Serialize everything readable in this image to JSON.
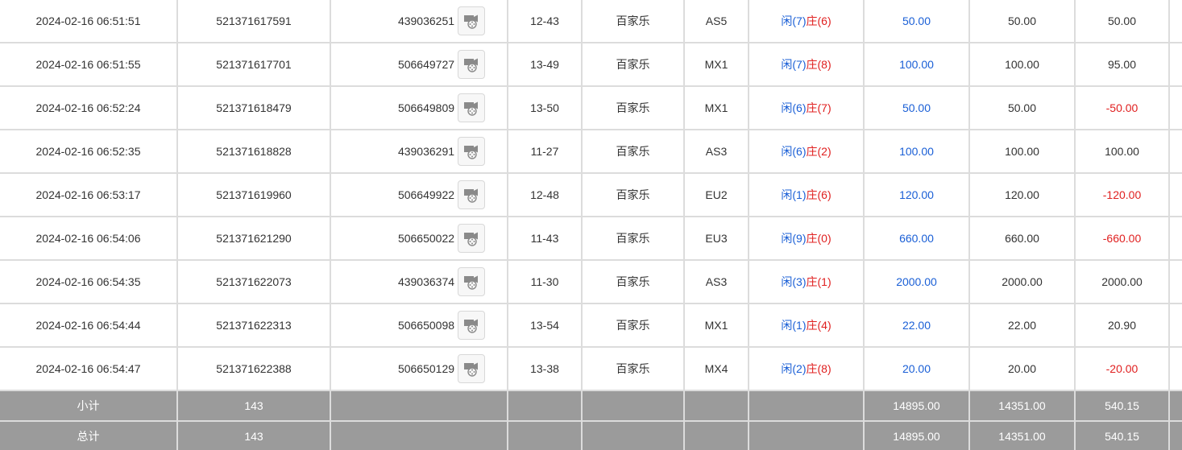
{
  "rows": [
    {
      "time": "2024-02-16 06:51:51",
      "bet_no": "521371617591",
      "round_no": "439036251",
      "shoe": "12-43",
      "game": "百家乐",
      "table": "AS5",
      "player_label": "闲(7)",
      "banker_label": "庄(6)",
      "bet_amount": "50.00",
      "valid_bet": "50.00",
      "win_loss": "50.00",
      "negative": false
    },
    {
      "time": "2024-02-16 06:51:55",
      "bet_no": "521371617701",
      "round_no": "506649727",
      "shoe": "13-49",
      "game": "百家乐",
      "table": "MX1",
      "player_label": "闲(7)",
      "banker_label": "庄(8)",
      "bet_amount": "100.00",
      "valid_bet": "100.00",
      "win_loss": "95.00",
      "negative": false
    },
    {
      "time": "2024-02-16 06:52:24",
      "bet_no": "521371618479",
      "round_no": "506649809",
      "shoe": "13-50",
      "game": "百家乐",
      "table": "MX1",
      "player_label": "闲(6)",
      "banker_label": "庄(7)",
      "bet_amount": "50.00",
      "valid_bet": "50.00",
      "win_loss": "-50.00",
      "negative": true
    },
    {
      "time": "2024-02-16 06:52:35",
      "bet_no": "521371618828",
      "round_no": "439036291",
      "shoe": "11-27",
      "game": "百家乐",
      "table": "AS3",
      "player_label": "闲(6)",
      "banker_label": "庄(2)",
      "bet_amount": "100.00",
      "valid_bet": "100.00",
      "win_loss": "100.00",
      "negative": false
    },
    {
      "time": "2024-02-16 06:53:17",
      "bet_no": "521371619960",
      "round_no": "506649922",
      "shoe": "12-48",
      "game": "百家乐",
      "table": "EU2",
      "player_label": "闲(1)",
      "banker_label": "庄(6)",
      "bet_amount": "120.00",
      "valid_bet": "120.00",
      "win_loss": "-120.00",
      "negative": true
    },
    {
      "time": "2024-02-16 06:54:06",
      "bet_no": "521371621290",
      "round_no": "506650022",
      "shoe": "11-43",
      "game": "百家乐",
      "table": "EU3",
      "player_label": "闲(9)",
      "banker_label": "庄(0)",
      "bet_amount": "660.00",
      "valid_bet": "660.00",
      "win_loss": "-660.00",
      "negative": true
    },
    {
      "time": "2024-02-16 06:54:35",
      "bet_no": "521371622073",
      "round_no": "439036374",
      "shoe": "11-30",
      "game": "百家乐",
      "table": "AS3",
      "player_label": "闲(3)",
      "banker_label": "庄(1)",
      "bet_amount": "2000.00",
      "valid_bet": "2000.00",
      "win_loss": "2000.00",
      "negative": false
    },
    {
      "time": "2024-02-16 06:54:44",
      "bet_no": "521371622313",
      "round_no": "506650098",
      "shoe": "13-54",
      "game": "百家乐",
      "table": "MX1",
      "player_label": "闲(1)",
      "banker_label": "庄(4)",
      "bet_amount": "22.00",
      "valid_bet": "22.00",
      "win_loss": "20.90",
      "negative": false
    },
    {
      "time": "2024-02-16 06:54:47",
      "bet_no": "521371622388",
      "round_no": "506650129",
      "shoe": "13-38",
      "game": "百家乐",
      "table": "MX4",
      "player_label": "闲(2)",
      "banker_label": "庄(8)",
      "bet_amount": "20.00",
      "valid_bet": "20.00",
      "win_loss": "-20.00",
      "negative": true
    }
  ],
  "subtotal": {
    "label": "小计",
    "count": "143",
    "bet_amount": "14895.00",
    "valid_bet": "14351.00",
    "win_loss": "540.15"
  },
  "total": {
    "label": "总计",
    "count": "143",
    "bet_amount": "14895.00",
    "valid_bet": "14351.00",
    "win_loss": "540.15"
  },
  "icons": {
    "video": "video-replay-icon"
  },
  "colors": {
    "player": "#1a5fd6",
    "banker": "#e02020",
    "amount": "#1a5fd6",
    "negative": "#e02020",
    "summary_bg": "#9b9b9b"
  }
}
